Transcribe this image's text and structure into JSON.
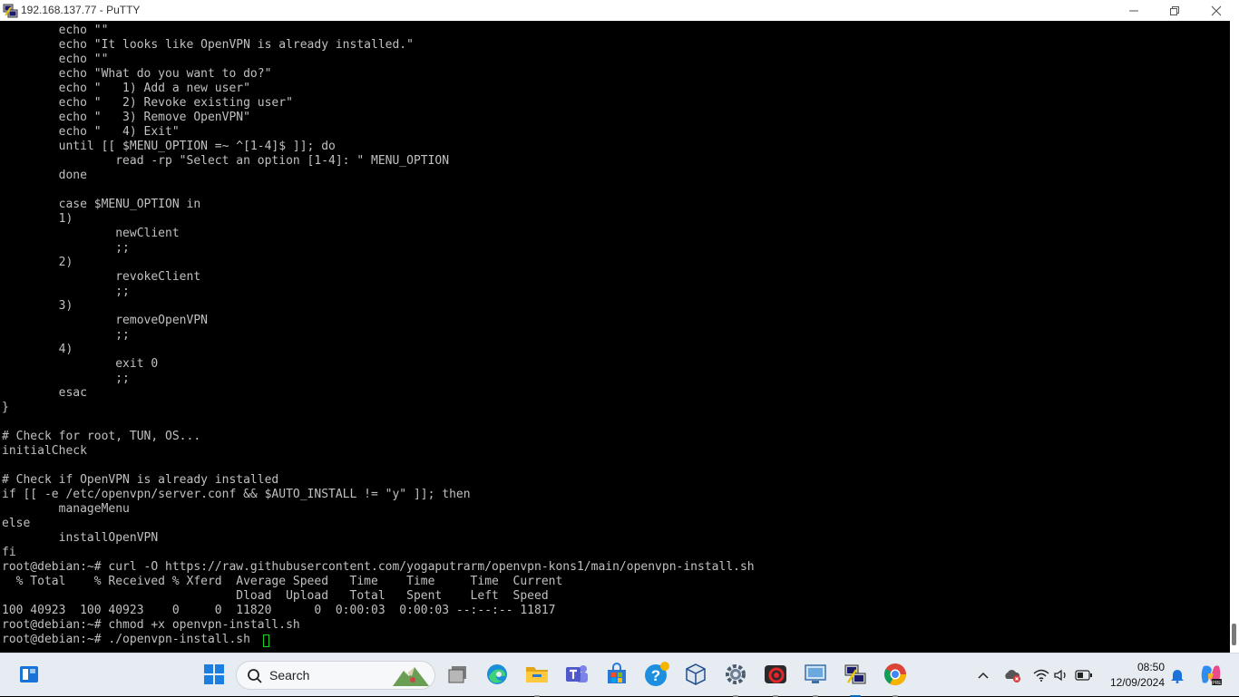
{
  "window": {
    "title": "192.168.137.77 - PuTTY"
  },
  "terminal": {
    "lines": [
      "        echo \"\"",
      "        echo \"It looks like OpenVPN is already installed.\"",
      "        echo \"\"",
      "        echo \"What do you want to do?\"",
      "        echo \"   1) Add a new user\"",
      "        echo \"   2) Revoke existing user\"",
      "        echo \"   3) Remove OpenVPN\"",
      "        echo \"   4) Exit\"",
      "        until [[ $MENU_OPTION =~ ^[1-4]$ ]]; do",
      "                read -rp \"Select an option [1-4]: \" MENU_OPTION",
      "        done",
      "",
      "        case $MENU_OPTION in",
      "        1)",
      "                newClient",
      "                ;;",
      "        2)",
      "                revokeClient",
      "                ;;",
      "        3)",
      "                removeOpenVPN",
      "                ;;",
      "        4)",
      "                exit 0",
      "                ;;",
      "        esac",
      "}",
      "",
      "# Check for root, TUN, OS...",
      "initialCheck",
      "",
      "# Check if OpenVPN is already installed",
      "if [[ -e /etc/openvpn/server.conf && $AUTO_INSTALL != \"y\" ]]; then",
      "        manageMenu",
      "else",
      "        installOpenVPN",
      "fi",
      "root@debian:~# curl -O https://raw.githubusercontent.com/yogaputrarm/openvpn-kons1/main/openvpn-install.sh",
      "  % Total    % Received % Xferd  Average Speed   Time    Time     Time  Current",
      "                                 Dload  Upload   Total   Spent    Left  Speed",
      "100 40923  100 40923    0     0  11820      0  0:00:03  0:00:03 --:--:-- 11817",
      "root@debian:~# chmod +x openvpn-install.sh",
      "root@debian:~# ./openvpn-install.sh "
    ],
    "text_color": "#c0c0c0",
    "cursor_color": "#1ad41a"
  },
  "taskbar": {
    "search_label": "Search",
    "clock_time": "08:50",
    "clock_date": "12/09/2024",
    "pinned": [
      "windows-start-icon",
      "task-view-icon",
      "edge-icon",
      "file-explorer-icon",
      "teams-icon",
      "microsoft-store-icon",
      "get-help-icon",
      "virtualbox-icon",
      "settings-icon",
      "screen-recorder-icon",
      "remote-desktop-icon",
      "putty-icon",
      "chrome-icon"
    ],
    "tray": [
      "show-hidden-icons-chevron",
      "onedrive-error-icon",
      "wifi-icon",
      "volume-icon",
      "battery-icon",
      "notification-bell-icon",
      "copilot-icon"
    ]
  },
  "colors": {
    "terminal_bg": "#000000",
    "taskbar_bg": "#e7ecf3",
    "accent": "#0067c0"
  }
}
